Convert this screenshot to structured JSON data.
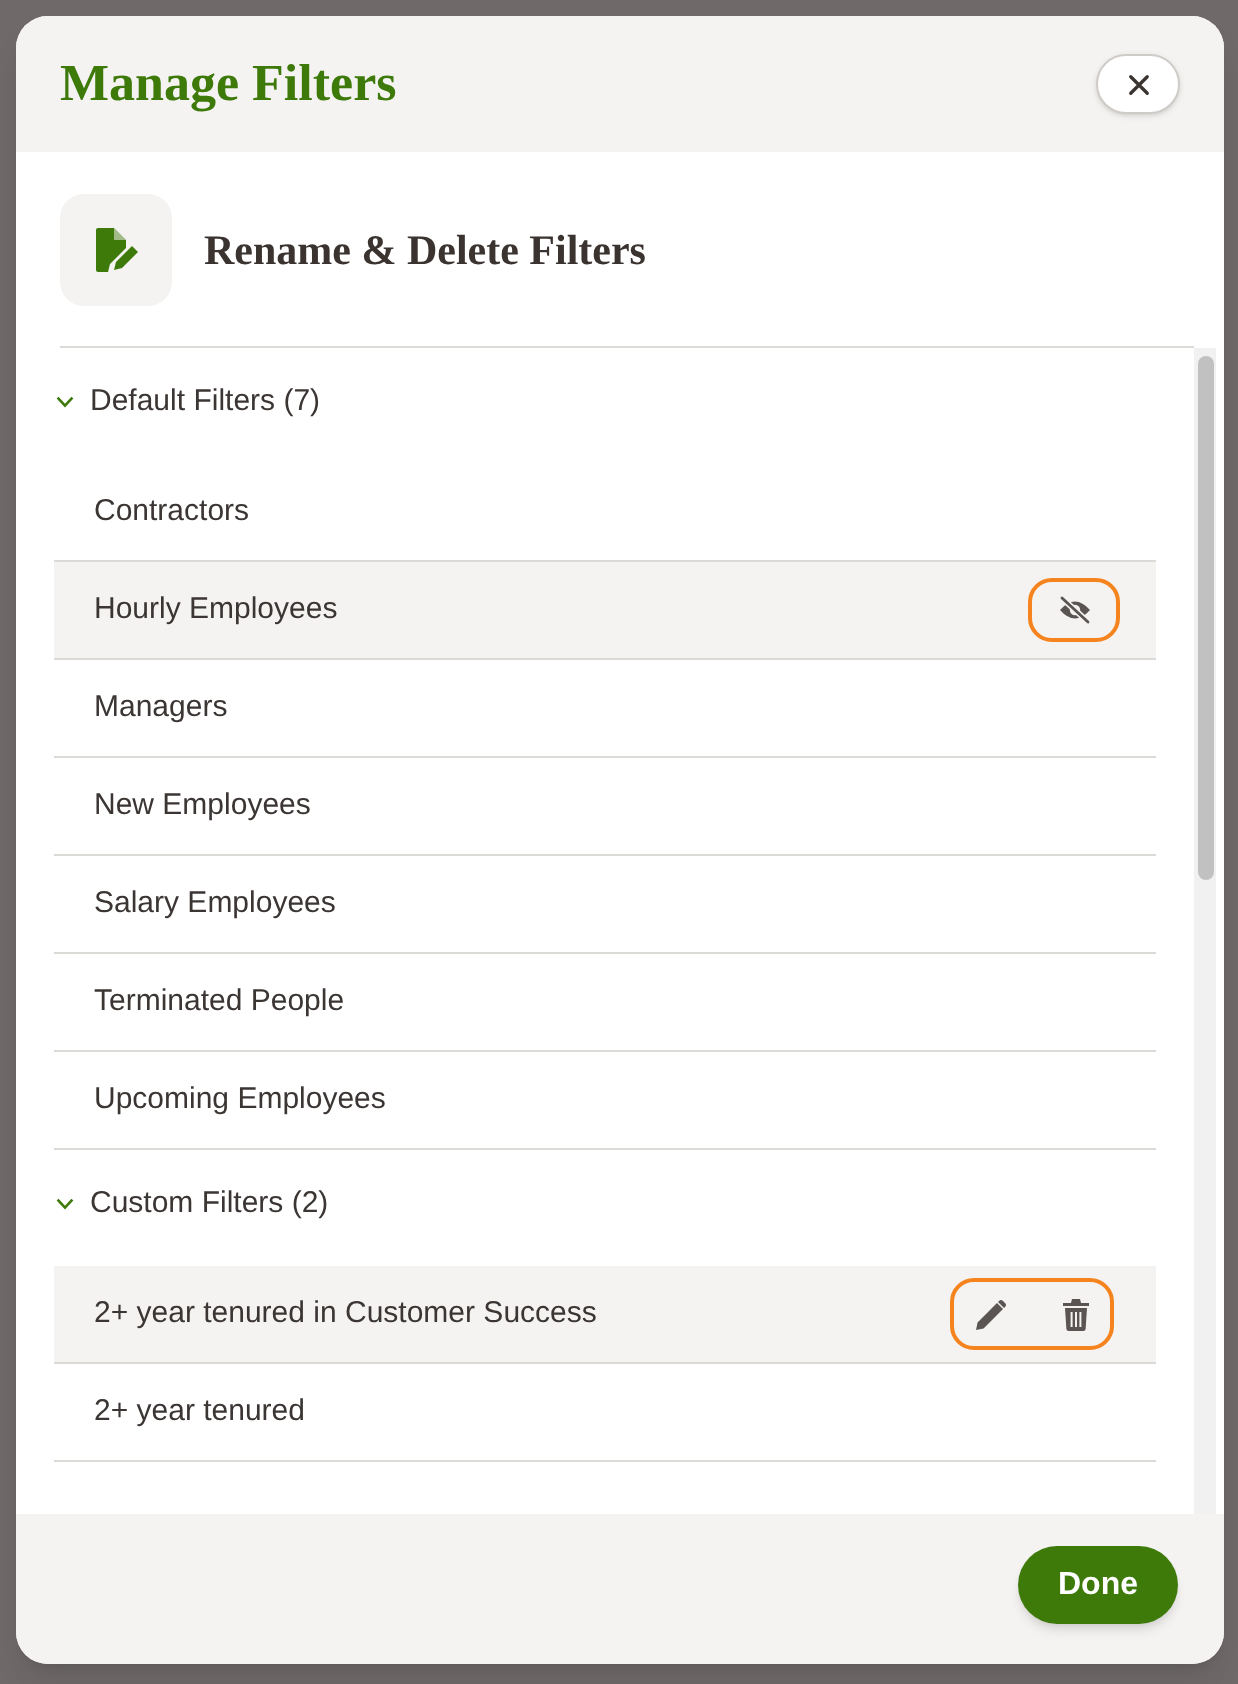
{
  "dialog": {
    "title": "Manage Filters"
  },
  "panel": {
    "title": "Rename & Delete Filters"
  },
  "sections": [
    {
      "kind": "default",
      "title": "Default Filters (7)",
      "expanded": true,
      "items": [
        {
          "label": "Contractors",
          "highlighted": false
        },
        {
          "label": "Hourly Employees",
          "highlighted": true
        },
        {
          "label": "Managers",
          "highlighted": false
        },
        {
          "label": "New Employees",
          "highlighted": false
        },
        {
          "label": "Salary Employees",
          "highlighted": false
        },
        {
          "label": "Terminated People",
          "highlighted": false
        },
        {
          "label": "Upcoming Employees",
          "highlighted": false
        }
      ]
    },
    {
      "kind": "custom",
      "title": "Custom Filters (2)",
      "expanded": true,
      "items": [
        {
          "label": "2+ year tenured in Customer Success",
          "highlighted": true
        },
        {
          "label": "2+ year tenured",
          "highlighted": false
        }
      ]
    }
  ],
  "footer": {
    "done_button": "Done"
  }
}
